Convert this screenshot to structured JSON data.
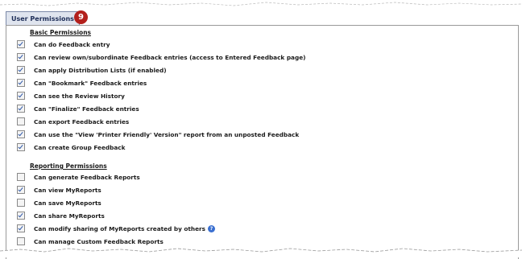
{
  "tab": {
    "label": "User Permissions"
  },
  "step_badge": "9",
  "basic": {
    "title": "Basic Permissions",
    "items": [
      {
        "label": "Can do Feedback entry",
        "checked": true
      },
      {
        "label": "Can review own/subordinate Feedback entries (access to Entered Feedback page)",
        "checked": true
      },
      {
        "label": "Can apply Distribution Lists (if enabled)",
        "checked": true
      },
      {
        "label": "Can \"Bookmark\" Feedback entries",
        "checked": true
      },
      {
        "label": "Can see the Review History",
        "checked": true
      },
      {
        "label": "Can \"Finalize\" Feedback entries",
        "checked": true
      },
      {
        "label": "Can export Feedback entries",
        "checked": false
      },
      {
        "label": "Can use the \"View 'Printer Friendly' Version\" report from an unposted Feedback",
        "checked": true
      },
      {
        "label": "Can create Group Feedback",
        "checked": true
      }
    ]
  },
  "reporting": {
    "title": "Reporting Permissions",
    "items": [
      {
        "label": "Can generate Feedback Reports",
        "checked": false
      },
      {
        "label": "Can view MyReports",
        "checked": true
      },
      {
        "label": "Can save MyReports",
        "checked": false
      },
      {
        "label": "Can share MyReports",
        "checked": true
      },
      {
        "label": "Can modify sharing of MyReports created by others",
        "checked": true,
        "help": "?"
      },
      {
        "label": "Can manage Custom Feedback Reports",
        "checked": false
      }
    ]
  },
  "colors": {
    "accent": "#2b55a6",
    "badge": "#b3201c",
    "tab_bg": "#dfe4ee"
  }
}
